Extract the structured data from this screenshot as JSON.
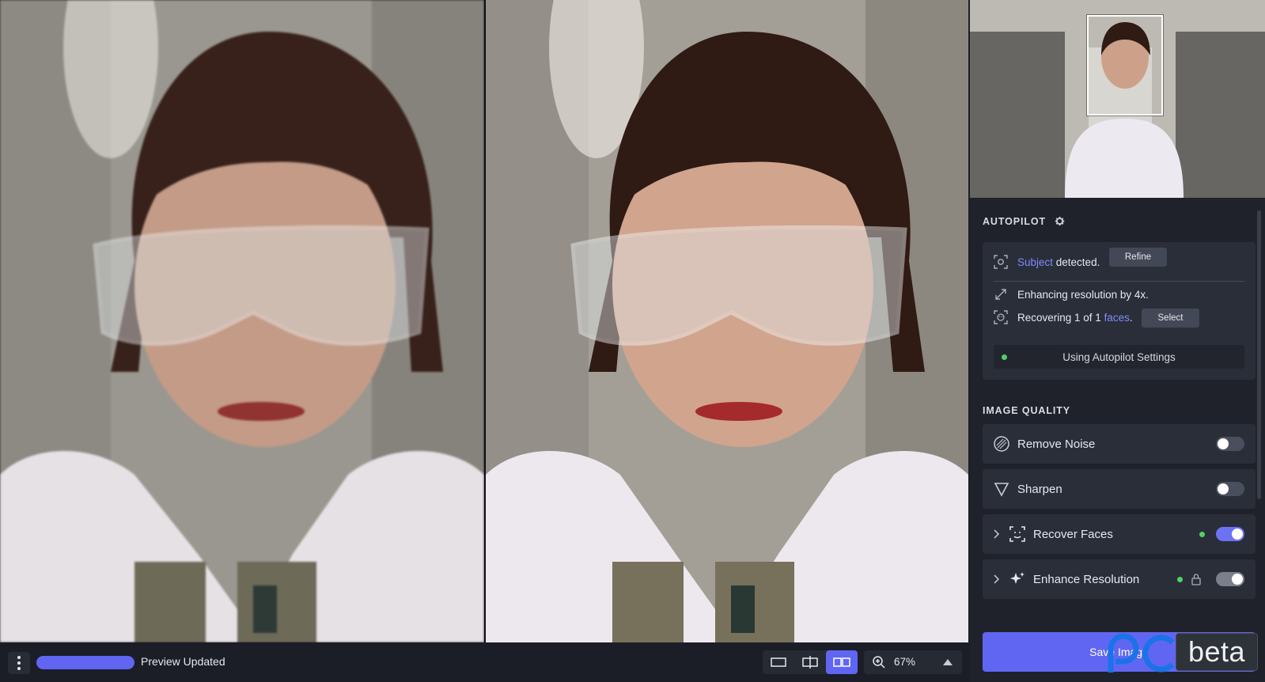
{
  "autopilot": {
    "heading": "AUTOPILOT",
    "subject_link": "Subject",
    "subject_suffix": " detected.",
    "refine_label": "Refine",
    "enhance_text": "Enhancing resolution by 4x.",
    "recover_prefix": "Recovering 1 of 1 ",
    "recover_link": "faces",
    "recover_suffix": ".",
    "select_label": "Select",
    "status_text": "Using Autopilot Settings"
  },
  "image_quality": {
    "heading": "IMAGE QUALITY",
    "rows": [
      {
        "label": "Remove Noise",
        "enabled": false,
        "expandable": false
      },
      {
        "label": "Sharpen",
        "enabled": false,
        "expandable": false
      },
      {
        "label": "Recover Faces",
        "enabled": true,
        "expandable": true,
        "autopilot": true
      },
      {
        "label": "Enhance Resolution",
        "enabled": true,
        "expandable": true,
        "autopilot": true,
        "locked": true
      }
    ]
  },
  "save": {
    "label": "Save Image"
  },
  "watermark": {
    "text": "beta"
  },
  "bottombar": {
    "status": "Preview Updated",
    "progress_percent": 100,
    "zoom": "67%",
    "view_modes": [
      "single-view",
      "split-view",
      "side-by-side"
    ],
    "active_view": "side-by-side"
  },
  "colors": {
    "accent": "#6166f2",
    "link": "#7f8cff",
    "status_green": "#52d162",
    "panel": "#1f222b",
    "card": "#2a2e38"
  }
}
